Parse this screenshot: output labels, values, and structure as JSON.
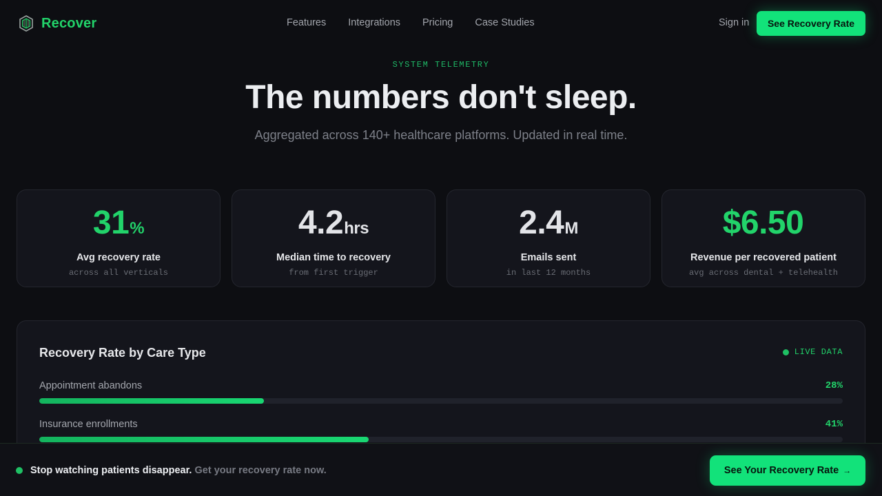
{
  "nav": {
    "brand_name": "Recover",
    "links": [
      "Features",
      "Integrations",
      "Pricing",
      "Case Studies"
    ],
    "sign_in": "Sign in",
    "cta": "See Recovery Rate"
  },
  "hero": {
    "eyebrow": "SYSTEM TELEMETRY",
    "headline": "The numbers don't sleep.",
    "subhead": "Aggregated across 140+ healthcare platforms. Updated in real time."
  },
  "stats": [
    {
      "value": "31",
      "unit": "%",
      "label": "Avg recovery rate",
      "sub": "across all verticals",
      "color": "#22d36a"
    },
    {
      "value": "4.2",
      "unit": "hrs",
      "label": "Median time to recovery",
      "sub": "from first trigger",
      "color": "#e3e4e8"
    },
    {
      "value": "2.4",
      "unit": "M",
      "label": "Emails sent",
      "sub": "in last 12 months",
      "color": "#e3e4e8"
    },
    {
      "value": "$6.50",
      "unit": "",
      "label": "Revenue per recovered patient",
      "sub": "avg across dental + telehealth",
      "color": "#22d36a"
    }
  ],
  "panel": {
    "title": "Recovery Rate by Care Type",
    "live_label": "LIVE DATA",
    "rows": [
      {
        "label": "Appointment abandons",
        "pct_text": "28%",
        "pct": 28
      },
      {
        "label": "Insurance enrollments",
        "pct_text": "41%",
        "pct": 41
      }
    ]
  },
  "banner": {
    "strong": "Stop watching patients disappear.",
    "muted": "Get your recovery rate now.",
    "cta": "See Your Recovery Rate",
    "cta_arrow": "→"
  },
  "colors": {
    "accent": "#12e27a",
    "accent_text": "#22d36a",
    "background": "#0d0e12",
    "card": "#14151c"
  }
}
